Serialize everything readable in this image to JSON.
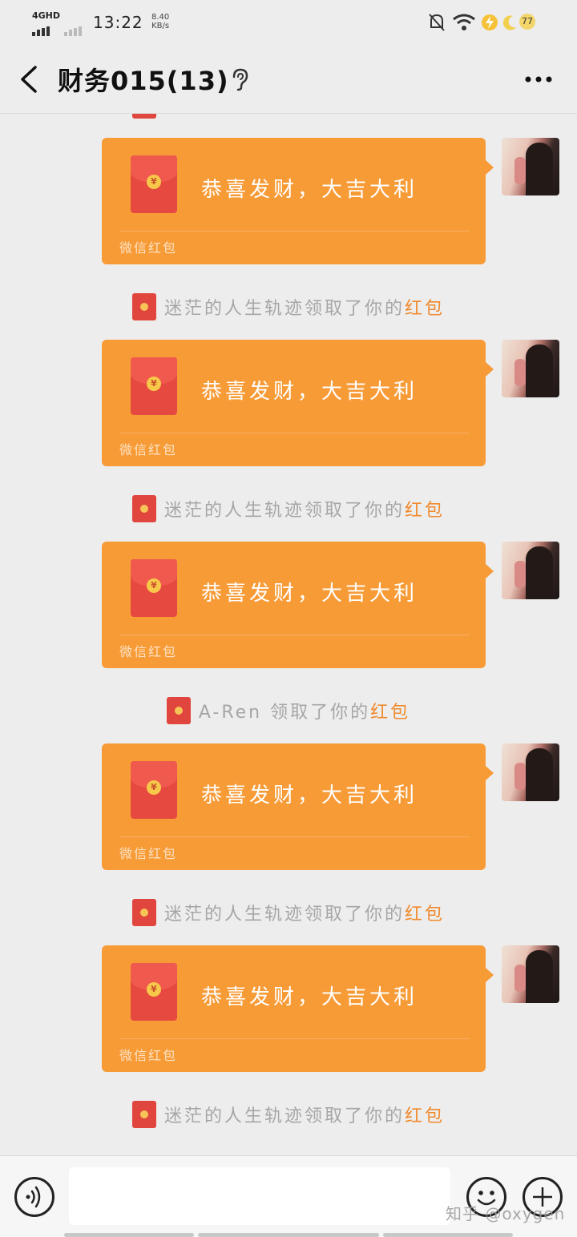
{
  "status_bar": {
    "network": "4GHD",
    "time": "13:22",
    "speed_value": "8.40",
    "speed_unit": "KB/s",
    "battery": "77"
  },
  "header": {
    "title": "财务015(13)"
  },
  "red_packet": {
    "greeting": "恭喜发财，大吉大利",
    "footer": "微信红包"
  },
  "messages": [
    {
      "notice_name": "迷茫的人生轨迹领取了你的",
      "notice_link": "红包"
    },
    {
      "notice_name": "迷茫的人生轨迹领取了你的",
      "notice_link": "红包"
    },
    {
      "notice_name": "迷茫的人生轨迹领取了你的",
      "notice_link": "红包"
    },
    {
      "notice_name": "A-Ren 领取了你的",
      "notice_link": "红包"
    },
    {
      "notice_name": "迷茫的人生轨迹领取了你的",
      "notice_link": "红包"
    },
    {
      "notice_name": "迷茫的人生轨迹领取了你的",
      "notice_link": "红包"
    }
  ],
  "input": {
    "placeholder": ""
  },
  "watermark": "知乎 @oxygen",
  "colors": {
    "bubble": "#f79b37",
    "packet": "#e6493f",
    "link": "#f08a2e",
    "background": "#ededed"
  },
  "icons": [
    "back-icon",
    "ear-icon",
    "more-icon",
    "voice-icon",
    "emoji-icon",
    "plus-icon"
  ]
}
